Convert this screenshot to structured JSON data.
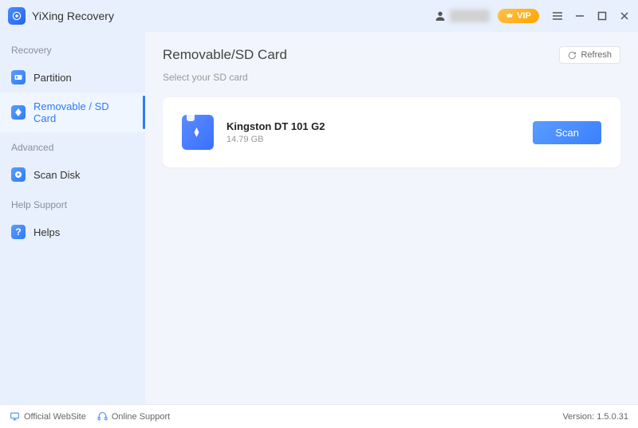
{
  "app": {
    "title": "YiXing Recovery"
  },
  "header": {
    "vip_label": "VIP"
  },
  "sidebar": {
    "recovery": {
      "title": "Recovery",
      "partition": "Partition",
      "removable": "Removable / SD Card"
    },
    "advanced": {
      "title": "Advanced",
      "scan_disk": "Scan Disk"
    },
    "help": {
      "title": "Help Support",
      "helps": "Helps"
    }
  },
  "content": {
    "title": "Removable/SD Card",
    "subtitle": "Select your SD card",
    "refresh_label": "Refresh",
    "device": {
      "name": "Kingston DT 101 G2",
      "size": "14.79 GB",
      "scan_label": "Scan"
    }
  },
  "statusbar": {
    "website": "Official WebSite",
    "support": "Online Support",
    "version": "Version: 1.5.0.31"
  }
}
